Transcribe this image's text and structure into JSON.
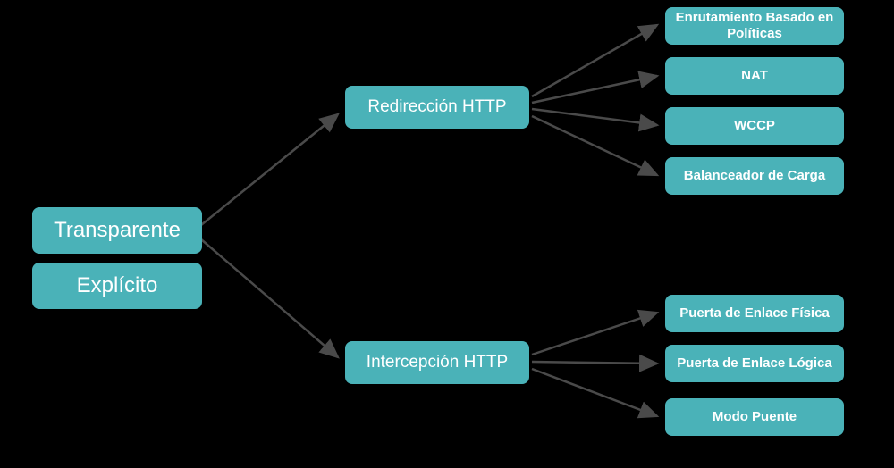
{
  "diagram": {
    "level1": {
      "transparente": "Transparente",
      "explicito": "Explícito"
    },
    "level2": {
      "redireccion": "Redirección HTTP",
      "intercepcion": "Intercepción HTTP"
    },
    "level3": {
      "redireccion_children": {
        "enrutamiento": "Enrutamiento Basado en Políticas",
        "nat": "NAT",
        "wccp": "WCCP",
        "balanceador": "Balanceador de Carga"
      },
      "intercepcion_children": {
        "puerta_fisica": "Puerta de Enlace Física",
        "puerta_logica": "Puerta de Enlace Lógica",
        "modo_puente": "Modo Puente"
      }
    }
  },
  "colors": {
    "node_bg": "#4ab2b8",
    "arrow": "#4a4a4a",
    "background": "#000000"
  }
}
